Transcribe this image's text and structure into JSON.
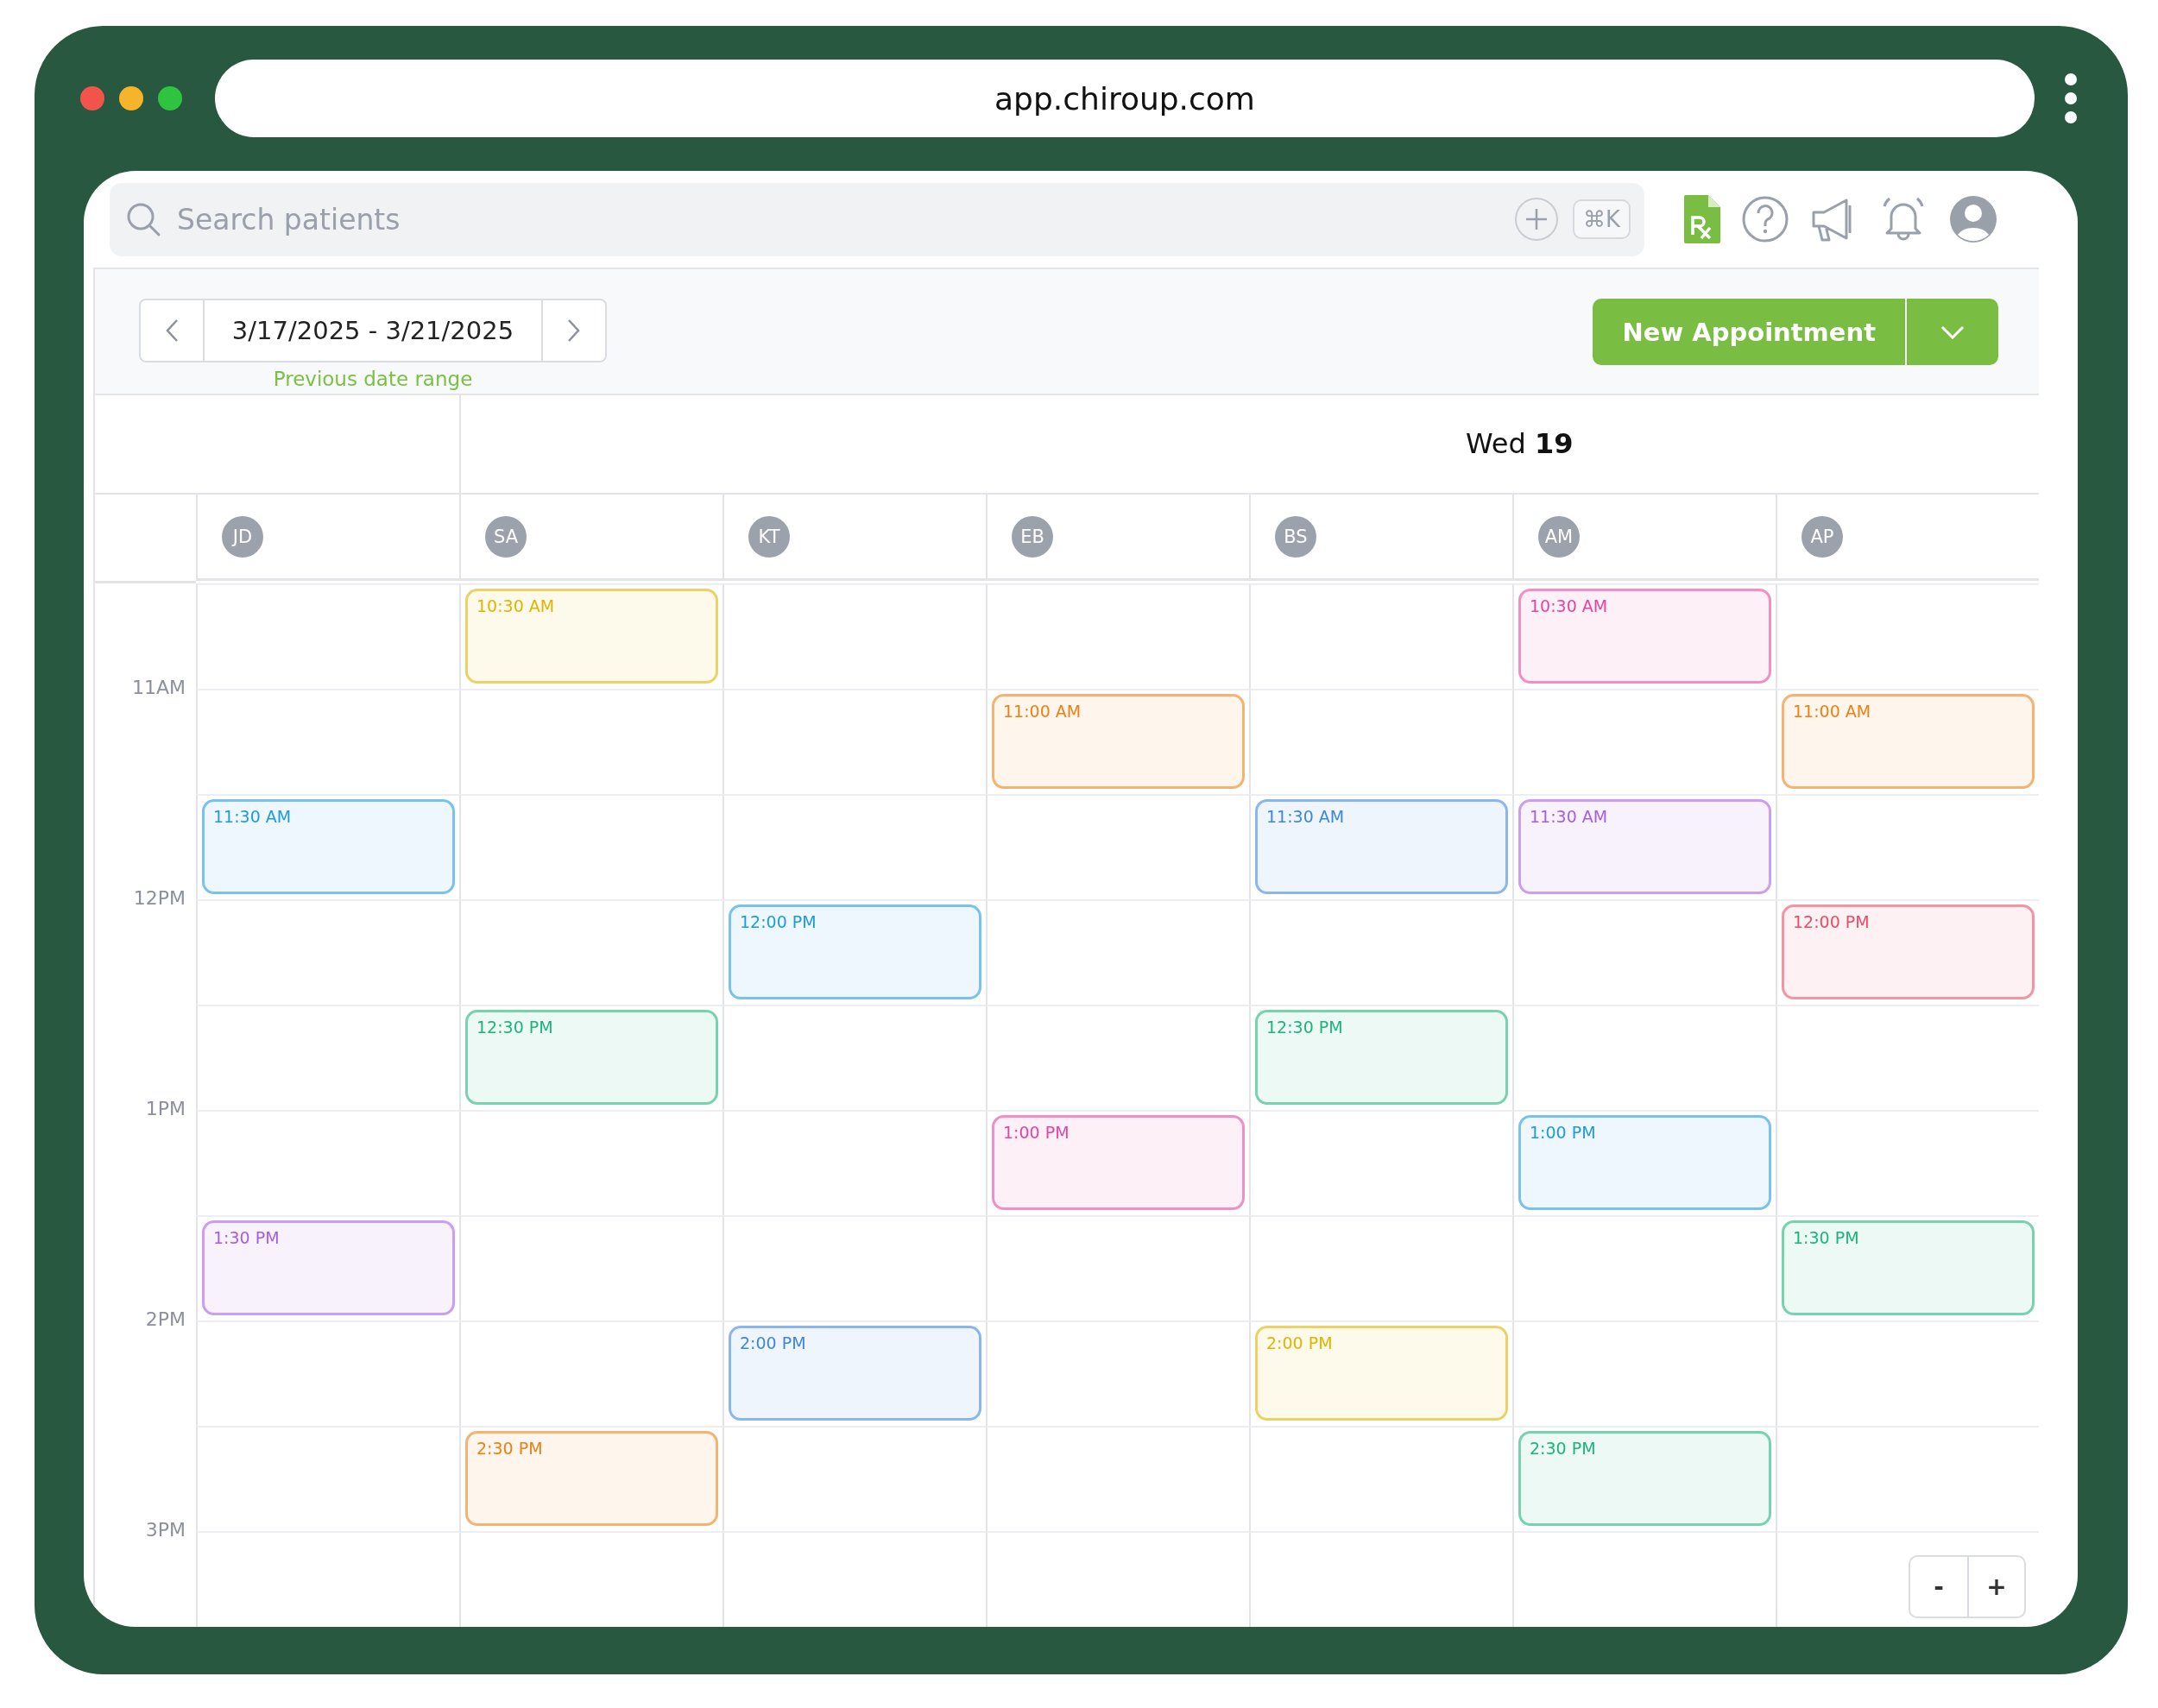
{
  "browser": {
    "url": "app.chiroup.com"
  },
  "search": {
    "placeholder": "Search patients",
    "shortcut": "⌘K"
  },
  "toolbar": {
    "date_range": "3/17/2025 - 3/21/2025",
    "date_hint": "Previous date range",
    "new_button": "New Appointment"
  },
  "day_header": "Wed **19**",
  "staff": [
    "JD",
    "SA",
    "KT",
    "EB",
    "BS",
    "AM",
    "AP"
  ],
  "rows": [
    {
      "cells": [
        null,
        {
          "time": "10:30 AM",
          "color": "#e0b400"
        },
        null,
        null,
        null,
        {
          "time": "10:30 AM",
          "color": "#e8449e"
        },
        null
      ]
    },
    {
      "time_label": "11AM",
      "cells": [
        null,
        null,
        null,
        {
          "time": "11:00 AM",
          "color": "#ee7f12"
        },
        null,
        null,
        {
          "time": "11:00 AM",
          "color": "#ee7f12"
        }
      ]
    },
    {
      "cells": [
        {
          "time": "11:30 AM",
          "color": "#1e9ae0"
        },
        null,
        null,
        null,
        {
          "time": "11:30 AM",
          "color": "#3d86e0"
        },
        {
          "time": "11:30 AM",
          "color": "#a65ee6"
        },
        null
      ]
    },
    {
      "time_label": "12PM",
      "cells": [
        null,
        null,
        {
          "time": "12:00 PM",
          "color": "#1e9ae0"
        },
        null,
        null,
        null,
        {
          "time": "12:00 PM",
          "color": "#ea4c64"
        }
      ]
    },
    {
      "cells": [
        null,
        {
          "time": "12:30 PM",
          "color": "#1cb47c"
        },
        null,
        null,
        {
          "time": "12:30 PM",
          "color": "#1cb47c"
        },
        null,
        null
      ]
    },
    {
      "time_label": "1PM",
      "cells": [
        null,
        null,
        null,
        {
          "time": "1:00 PM",
          "color": "#e8449e"
        },
        null,
        {
          "time": "1:00 PM",
          "color": "#1e9ae0"
        },
        null
      ]
    },
    {
      "cells": [
        {
          "time": "1:30 PM",
          "color": "#a65ee6"
        },
        null,
        null,
        null,
        null,
        null,
        {
          "time": "1:30 PM",
          "color": "#1cb47c"
        }
      ]
    },
    {
      "time_label": "2PM",
      "cells": [
        null,
        null,
        {
          "time": "2:00 PM",
          "color": "#3d86e0"
        },
        null,
        {
          "time": "2:00 PM",
          "color": "#e0b400"
        },
        null,
        null
      ]
    },
    {
      "cells": [
        null,
        {
          "time": "2:30 PM",
          "color": "#ee7f12"
        },
        null,
        null,
        null,
        {
          "time": "2:30 PM",
          "color": "#1cb47c"
        },
        null
      ]
    },
    {
      "time_label": "3PM",
      "cells": [
        null,
        null,
        null,
        null,
        null,
        null,
        null
      ]
    }
  ],
  "zoom_controls": [
    "-",
    "+"
  ]
}
